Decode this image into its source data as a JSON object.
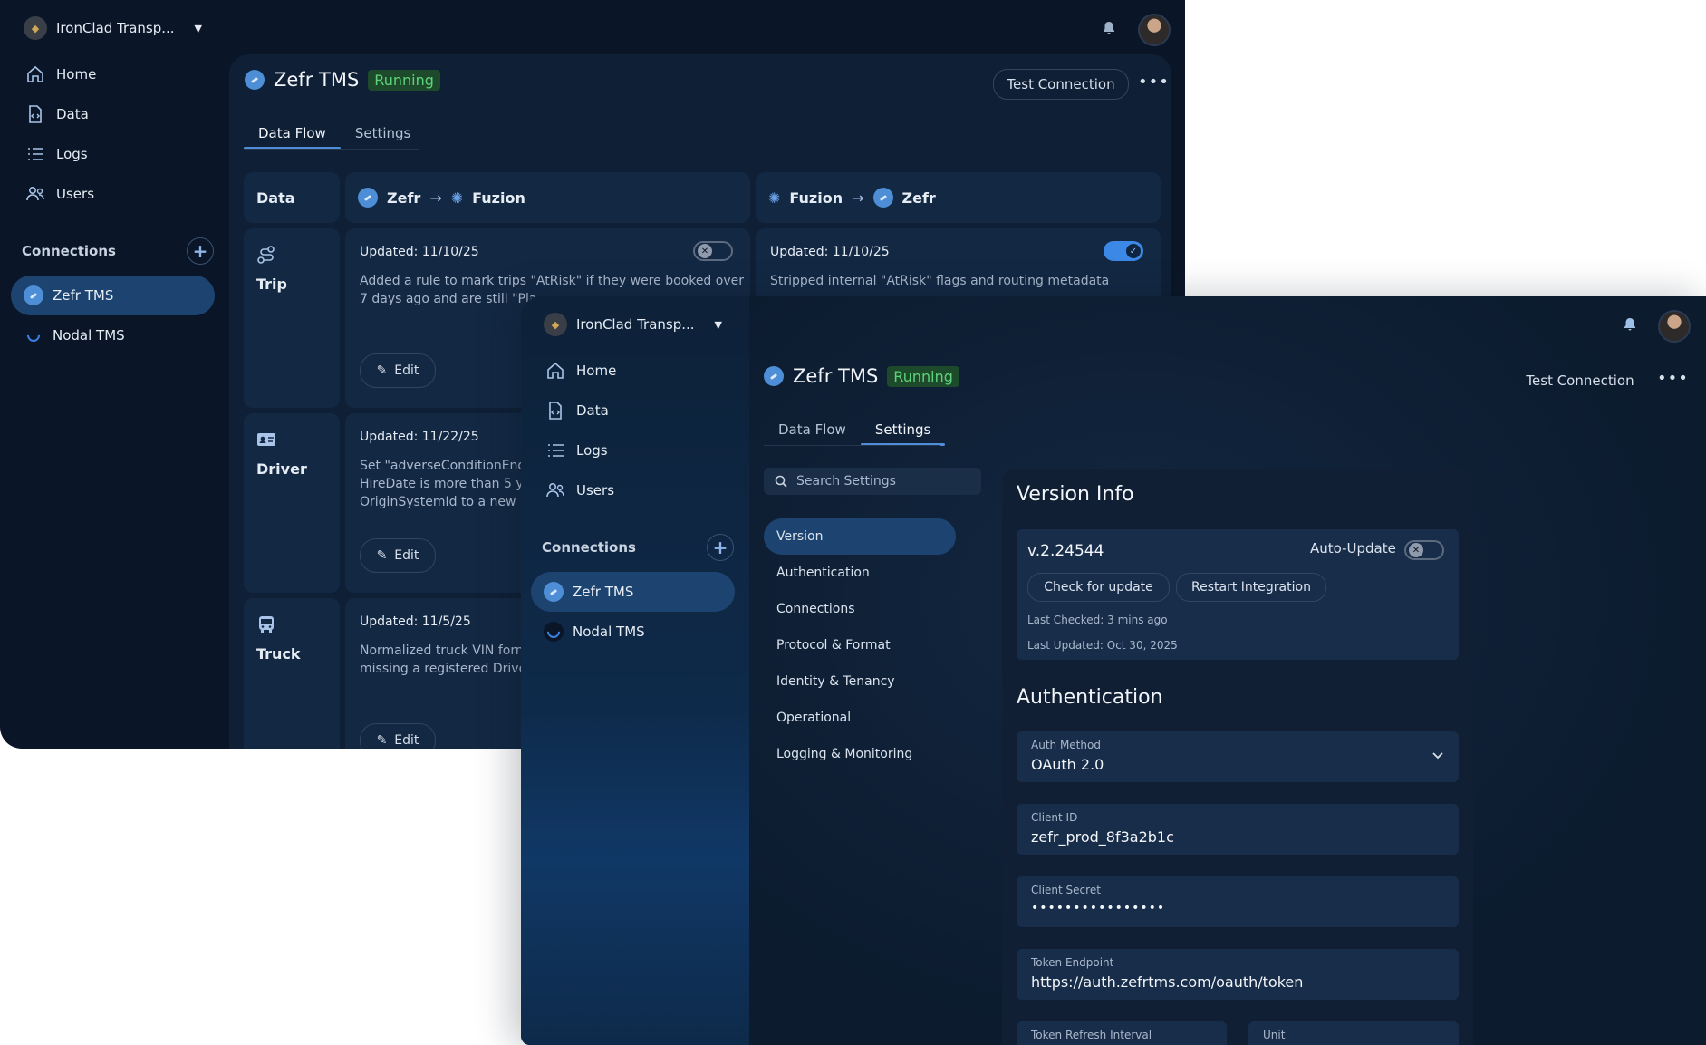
{
  "back": {
    "org_name": "IronClad Transp...",
    "nav": [
      "Home",
      "Data",
      "Logs",
      "Users"
    ],
    "connections_title": "Connections",
    "connections": [
      "Zefr TMS",
      "Nodal TMS"
    ],
    "title": "Zefr TMS",
    "status": "Running",
    "test_connection": "Test Connection",
    "tabs": [
      "Data Flow",
      "Settings"
    ],
    "grid": {
      "data_header": "Data",
      "col1": {
        "from": "Zefr",
        "to": "Fuzion"
      },
      "col2": {
        "from": "Fuzion",
        "to": "Zefr"
      },
      "rows": [
        {
          "label": "Trip",
          "c1_updated": "Updated: 11/10/25",
          "c1_desc": "Added a rule to mark trips \"AtRisk\" if they were booked over\n7 days ago and are still \"Pla",
          "c2_updated": "Updated: 11/10/25",
          "c2_desc": "Stripped internal \"AtRisk\" flags and routing metadata"
        },
        {
          "label": "Driver",
          "c1_updated": "Updated: 11/22/25",
          "c1_desc": "Set \"adverseConditionEnd\nHireDate is more than 5 ye\nOriginSystemId to a new I"
        },
        {
          "label": "Truck",
          "c1_updated": "Updated: 11/5/25",
          "c1_desc": "Normalized truck VIN form\nmissing a registered Drive"
        }
      ],
      "edit_label": "Edit",
      "toggle_c1": "off",
      "toggle_c2": "on"
    }
  },
  "front": {
    "org_name": "IronClad Transp...",
    "nav": [
      "Home",
      "Data",
      "Logs",
      "Users"
    ],
    "connections_title": "Connections",
    "connections": [
      "Zefr TMS",
      "Nodal TMS"
    ],
    "title": "Zefr TMS",
    "status": "Running",
    "test_connection": "Test Connection",
    "tabs": [
      "Data Flow",
      "Settings"
    ],
    "search_placeholder": "Search Settings",
    "settings_nav": [
      "Version",
      "Authentication",
      "Connections",
      "Protocol & Format",
      "Identity & Tenancy",
      "Operational",
      "Logging & Monitoring"
    ],
    "version_info": {
      "title": "Version Info",
      "version": "v.2.24544",
      "auto_update_label": "Auto-Update",
      "auto_update": "off",
      "check_button": "Check for update",
      "restart_button": "Restart Integration",
      "last_checked": "Last Checked: 3 mins ago",
      "last_updated": "Last Updated: Oct 30, 2025"
    },
    "authentication": {
      "title": "Authentication",
      "auth_method_label": "Auth Method",
      "auth_method": "OAuth 2.0",
      "client_id_label": "Client ID",
      "client_id": "zefr_prod_8f3a2b1c",
      "client_secret_label": "Client Secret",
      "client_secret": "••••••••••••••••",
      "token_endpoint_label": "Token Endpoint",
      "token_endpoint": "https://auth.zefrtms.com/oauth/token",
      "refresh_label": "Token Refresh Interval",
      "unit_label": "Unit"
    }
  },
  "colors": {
    "accent": "#4d8ed6",
    "running_bg": "#1d4a2b",
    "running_text": "#5ed27a",
    "bg": "#0a1627"
  }
}
